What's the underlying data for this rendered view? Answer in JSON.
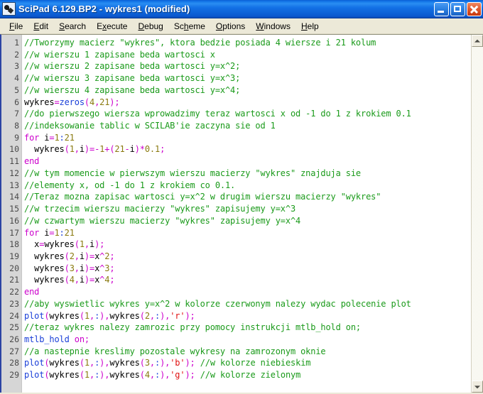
{
  "window": {
    "title": "SciPad 6.129.BP2 - wykres1 (modified)",
    "app_icon": "scipad-icon",
    "controls": {
      "minimize": "minimize-button",
      "maximize": "maximize-button",
      "close": "close-button"
    }
  },
  "menubar": {
    "items": [
      {
        "label": "File",
        "pre": "",
        "acc": "F",
        "post": "ile"
      },
      {
        "label": "Edit",
        "pre": "",
        "acc": "E",
        "post": "dit"
      },
      {
        "label": "Search",
        "pre": "",
        "acc": "S",
        "post": "earch"
      },
      {
        "label": "Execute",
        "pre": "E",
        "acc": "x",
        "post": "ecute"
      },
      {
        "label": "Debug",
        "pre": "",
        "acc": "D",
        "post": "ebug"
      },
      {
        "label": "Scheme",
        "pre": "Sc",
        "acc": "h",
        "post": "eme"
      },
      {
        "label": "Options",
        "pre": "",
        "acc": "O",
        "post": "ptions"
      },
      {
        "label": "Windows",
        "pre": "",
        "acc": "W",
        "post": "indows"
      },
      {
        "label": "Help",
        "pre": "",
        "acc": "H",
        "post": "elp"
      }
    ]
  },
  "scrollbar": {
    "up_arrow": "scroll-up-icon",
    "down_arrow": "scroll-down-icon"
  },
  "editor": {
    "language": "scilab",
    "first_visible_line": 1,
    "last_visible_line": 29,
    "line_numbers": [
      1,
      2,
      3,
      4,
      5,
      6,
      7,
      8,
      9,
      10,
      11,
      12,
      13,
      14,
      15,
      16,
      17,
      18,
      19,
      20,
      21,
      22,
      23,
      24,
      25,
      26,
      27,
      28,
      29
    ],
    "lines": [
      {
        "n": 1,
        "text": "//Tworzymy macierz \"wykres\", ktora bedzie posiada 4 wiersze i 21 kolum"
      },
      {
        "n": 2,
        "text": "//w wierszu 1 zapisane beda wartosci x"
      },
      {
        "n": 3,
        "text": "//w wierszu 2 zapisane beda wartosci y=x^2;"
      },
      {
        "n": 4,
        "text": "//w wierszu 3 zapisane beda wartosci y=x^3;"
      },
      {
        "n": 5,
        "text": "//w wierszu 4 zapisane beda wartosci y=x^4;"
      },
      {
        "n": 6,
        "text": "wykres=zeros(4,21);"
      },
      {
        "n": 7,
        "text": "//do pierwszego wiersza wprowadzimy teraz wartosci x od -1 do 1 z krokiem 0.1"
      },
      {
        "n": 8,
        "text": "//indeksowanie tablic w SCILAB'ie zaczyna sie od 1"
      },
      {
        "n": 9,
        "text": "for i=1:21"
      },
      {
        "n": 10,
        "text": "  wykres(1,i)=-1+(21-i)*0.1;"
      },
      {
        "n": 11,
        "text": "end"
      },
      {
        "n": 12,
        "text": "//w tym momencie w pierwszym wierszu macierzy \"wykres\" znajduja sie"
      },
      {
        "n": 13,
        "text": "//elementy x, od -1 do 1 z krokiem co 0.1."
      },
      {
        "n": 14,
        "text": "//Teraz mozna zapisac wartosci y=x^2 w drugim wierszu macierzy \"wykres\""
      },
      {
        "n": 15,
        "text": "//w trzecim wierszu macierzy \"wykres\" zapisujemy y=x^3"
      },
      {
        "n": 16,
        "text": "//w czwartym wierszu macierzy \"wykres\" zapisujemy y=x^4"
      },
      {
        "n": 17,
        "text": "for i=1:21"
      },
      {
        "n": 18,
        "text": "  x=wykres(1,i);"
      },
      {
        "n": 19,
        "text": "  wykres(2,i)=x^2;"
      },
      {
        "n": 20,
        "text": "  wykres(3,i)=x^3;"
      },
      {
        "n": 21,
        "text": "  wykres(4,i)=x^4;"
      },
      {
        "n": 22,
        "text": "end"
      },
      {
        "n": 23,
        "text": "//aby wyswietlic wykres y=x^2 w kolorze czerwonym nalezy wydac polecenie plot"
      },
      {
        "n": 24,
        "text": "plot(wykres(1,:),wykres(2,:),'r');"
      },
      {
        "n": 25,
        "text": "//teraz wykres nalezy zamrozic przy pomocy instrukcji mtlb_hold on;"
      },
      {
        "n": 26,
        "text": "mtlb_hold on;"
      },
      {
        "n": 27,
        "text": "//a nastepnie kreslimy pozostale wykresy na zamrozonym oknie"
      },
      {
        "n": 28,
        "text": "plot(wykres(1,:),wykres(3,:),'b'); //w kolorze niebieskim"
      },
      {
        "n": 29,
        "text": "plot(wykres(1,:),wykres(4,:),'g'); //w kolorze zielonym"
      }
    ],
    "tokens": [
      [
        [
          "//Tworzymy macierz \"wykres\", ktora bedzie posiada 4 wiersze i 21 kolum",
          "c-com"
        ]
      ],
      [
        [
          "//w wierszu 1 zapisane beda wartosci x",
          "c-com"
        ]
      ],
      [
        [
          "//w wierszu 2 zapisane beda wartosci y=x^2;",
          "c-com"
        ]
      ],
      [
        [
          "//w wierszu 3 zapisane beda wartosci y=x^3;",
          "c-com"
        ]
      ],
      [
        [
          "//w wierszu 4 zapisane beda wartosci y=x^4;",
          "c-com"
        ]
      ],
      [
        [
          "wykres",
          "c-txt"
        ],
        [
          "=",
          "c-op"
        ],
        [
          "zeros",
          "c-fn"
        ],
        [
          "(",
          "c-punc"
        ],
        [
          "4",
          "c-num"
        ],
        [
          ",",
          "c-punc"
        ],
        [
          "21",
          "c-num"
        ],
        [
          ")",
          "c-punc"
        ],
        [
          ";",
          "c-punc"
        ]
      ],
      [
        [
          "//do pierwszego wiersza wprowadzimy teraz wartosci x od -1 do 1 z krokiem 0.1",
          "c-com"
        ]
      ],
      [
        [
          "//indeksowanie tablic w SCILAB'ie zaczyna sie od 1",
          "c-com"
        ]
      ],
      [
        [
          "for",
          "c-kw"
        ],
        [
          " i",
          "c-txt"
        ],
        [
          "=",
          "c-op"
        ],
        [
          "1",
          "c-num"
        ],
        [
          ":",
          "c-colon"
        ],
        [
          "21",
          "c-num"
        ]
      ],
      [
        [
          "  wykres",
          "c-txt"
        ],
        [
          "(",
          "c-punc"
        ],
        [
          "1",
          "c-num"
        ],
        [
          ",",
          "c-punc"
        ],
        [
          "i",
          "c-txt"
        ],
        [
          ")",
          "c-punc"
        ],
        [
          "=",
          "c-op"
        ],
        [
          "-",
          "c-op"
        ],
        [
          "1",
          "c-num"
        ],
        [
          "+",
          "c-op"
        ],
        [
          "(",
          "c-punc"
        ],
        [
          "21",
          "c-num"
        ],
        [
          "-",
          "c-op"
        ],
        [
          "i",
          "c-txt"
        ],
        [
          ")",
          "c-punc"
        ],
        [
          "*",
          "c-op"
        ],
        [
          "0.1",
          "c-num"
        ],
        [
          ";",
          "c-punc"
        ]
      ],
      [
        [
          "end",
          "c-kw"
        ]
      ],
      [
        [
          "//w tym momencie w pierwszym wierszu macierzy \"wykres\" znajduja sie",
          "c-com"
        ]
      ],
      [
        [
          "//elementy x, od -1 do 1 z krokiem co 0.1.",
          "c-com"
        ]
      ],
      [
        [
          "//Teraz mozna zapisac wartosci y=x^2 w drugim wierszu macierzy \"wykres\"",
          "c-com"
        ]
      ],
      [
        [
          "//w trzecim wierszu macierzy \"wykres\" zapisujemy y=x^3",
          "c-com"
        ]
      ],
      [
        [
          "//w czwartym wierszu macierzy \"wykres\" zapisujemy y=x^4",
          "c-com"
        ]
      ],
      [
        [
          "for",
          "c-kw"
        ],
        [
          " i",
          "c-txt"
        ],
        [
          "=",
          "c-op"
        ],
        [
          "1",
          "c-num"
        ],
        [
          ":",
          "c-colon"
        ],
        [
          "21",
          "c-num"
        ]
      ],
      [
        [
          "  x",
          "c-txt"
        ],
        [
          "=",
          "c-op"
        ],
        [
          "wykres",
          "c-txt"
        ],
        [
          "(",
          "c-punc"
        ],
        [
          "1",
          "c-num"
        ],
        [
          ",",
          "c-punc"
        ],
        [
          "i",
          "c-txt"
        ],
        [
          ")",
          "c-punc"
        ],
        [
          ";",
          "c-punc"
        ]
      ],
      [
        [
          "  wykres",
          "c-txt"
        ],
        [
          "(",
          "c-punc"
        ],
        [
          "2",
          "c-num"
        ],
        [
          ",",
          "c-punc"
        ],
        [
          "i",
          "c-txt"
        ],
        [
          ")",
          "c-punc"
        ],
        [
          "=",
          "c-op"
        ],
        [
          "x",
          "c-txt"
        ],
        [
          "^",
          "c-op"
        ],
        [
          "2",
          "c-num"
        ],
        [
          ";",
          "c-punc"
        ]
      ],
      [
        [
          "  wykres",
          "c-txt"
        ],
        [
          "(",
          "c-punc"
        ],
        [
          "3",
          "c-num"
        ],
        [
          ",",
          "c-punc"
        ],
        [
          "i",
          "c-txt"
        ],
        [
          ")",
          "c-punc"
        ],
        [
          "=",
          "c-op"
        ],
        [
          "x",
          "c-txt"
        ],
        [
          "^",
          "c-op"
        ],
        [
          "3",
          "c-num"
        ],
        [
          ";",
          "c-punc"
        ]
      ],
      [
        [
          "  wykres",
          "c-txt"
        ],
        [
          "(",
          "c-punc"
        ],
        [
          "4",
          "c-num"
        ],
        [
          ",",
          "c-punc"
        ],
        [
          "i",
          "c-txt"
        ],
        [
          ")",
          "c-punc"
        ],
        [
          "=",
          "c-op"
        ],
        [
          "x",
          "c-txt"
        ],
        [
          "^",
          "c-op"
        ],
        [
          "4",
          "c-num"
        ],
        [
          ";",
          "c-punc"
        ]
      ],
      [
        [
          "end",
          "c-kw"
        ]
      ],
      [
        [
          "//aby wyswietlic wykres y=x^2 w kolorze czerwonym nalezy wydac polecenie plot",
          "c-com"
        ]
      ],
      [
        [
          "plot",
          "c-fn"
        ],
        [
          "(",
          "c-punc"
        ],
        [
          "wykres",
          "c-txt"
        ],
        [
          "(",
          "c-punc"
        ],
        [
          "1",
          "c-num"
        ],
        [
          ",",
          "c-punc"
        ],
        [
          ":",
          "c-colon"
        ],
        [
          ")",
          "c-punc"
        ],
        [
          ",",
          "c-punc"
        ],
        [
          "wykres",
          "c-txt"
        ],
        [
          "(",
          "c-punc"
        ],
        [
          "2",
          "c-num"
        ],
        [
          ",",
          "c-punc"
        ],
        [
          ":",
          "c-colon"
        ],
        [
          ")",
          "c-punc"
        ],
        [
          ",",
          "c-punc"
        ],
        [
          "'r'",
          "c-str"
        ],
        [
          ")",
          "c-punc"
        ],
        [
          ";",
          "c-punc"
        ]
      ],
      [
        [
          "//teraz wykres nalezy zamrozic przy pomocy instrukcji mtlb_hold on;",
          "c-com"
        ]
      ],
      [
        [
          "mtlb_hold",
          "c-fn"
        ],
        [
          " ",
          "c-txt"
        ],
        [
          "on",
          "c-kw"
        ],
        [
          ";",
          "c-punc"
        ]
      ],
      [
        [
          "//a nastepnie kreslimy pozostale wykresy na zamrozonym oknie",
          "c-com"
        ]
      ],
      [
        [
          "plot",
          "c-fn"
        ],
        [
          "(",
          "c-punc"
        ],
        [
          "wykres",
          "c-txt"
        ],
        [
          "(",
          "c-punc"
        ],
        [
          "1",
          "c-num"
        ],
        [
          ",",
          "c-punc"
        ],
        [
          ":",
          "c-colon"
        ],
        [
          ")",
          "c-punc"
        ],
        [
          ",",
          "c-punc"
        ],
        [
          "wykres",
          "c-txt"
        ],
        [
          "(",
          "c-punc"
        ],
        [
          "3",
          "c-num"
        ],
        [
          ",",
          "c-punc"
        ],
        [
          ":",
          "c-colon"
        ],
        [
          ")",
          "c-punc"
        ],
        [
          ",",
          "c-punc"
        ],
        [
          "'b'",
          "c-str"
        ],
        [
          ")",
          "c-punc"
        ],
        [
          ";",
          "c-punc"
        ],
        [
          " //w kolorze niebieskim",
          "c-com"
        ]
      ],
      [
        [
          "plot",
          "c-fn"
        ],
        [
          "(",
          "c-punc"
        ],
        [
          "wykres",
          "c-txt"
        ],
        [
          "(",
          "c-punc"
        ],
        [
          "1",
          "c-num"
        ],
        [
          ",",
          "c-punc"
        ],
        [
          ":",
          "c-colon"
        ],
        [
          ")",
          "c-punc"
        ],
        [
          ",",
          "c-punc"
        ],
        [
          "wykres",
          "c-txt"
        ],
        [
          "(",
          "c-punc"
        ],
        [
          "4",
          "c-num"
        ],
        [
          ",",
          "c-punc"
        ],
        [
          ":",
          "c-colon"
        ],
        [
          ")",
          "c-punc"
        ],
        [
          ",",
          "c-punc"
        ],
        [
          "'g'",
          "c-str"
        ],
        [
          ")",
          "c-punc"
        ],
        [
          ";",
          "c-punc"
        ],
        [
          " //w kolorze zielonym",
          "c-com"
        ]
      ]
    ]
  },
  "colors": {
    "titlebar_blue": "#1576e8",
    "menubar_bg": "#ece9d8",
    "gutter_bg": "#d6d6d6",
    "editor_bg": "#ffffff",
    "comment": "#1a9a1a",
    "keyword": "#cc00cc",
    "function": "#1a3fd8",
    "number": "#8a7a10",
    "string": "#e01010",
    "punctuation": "#cc00cc",
    "close_button": "#c6370d"
  }
}
